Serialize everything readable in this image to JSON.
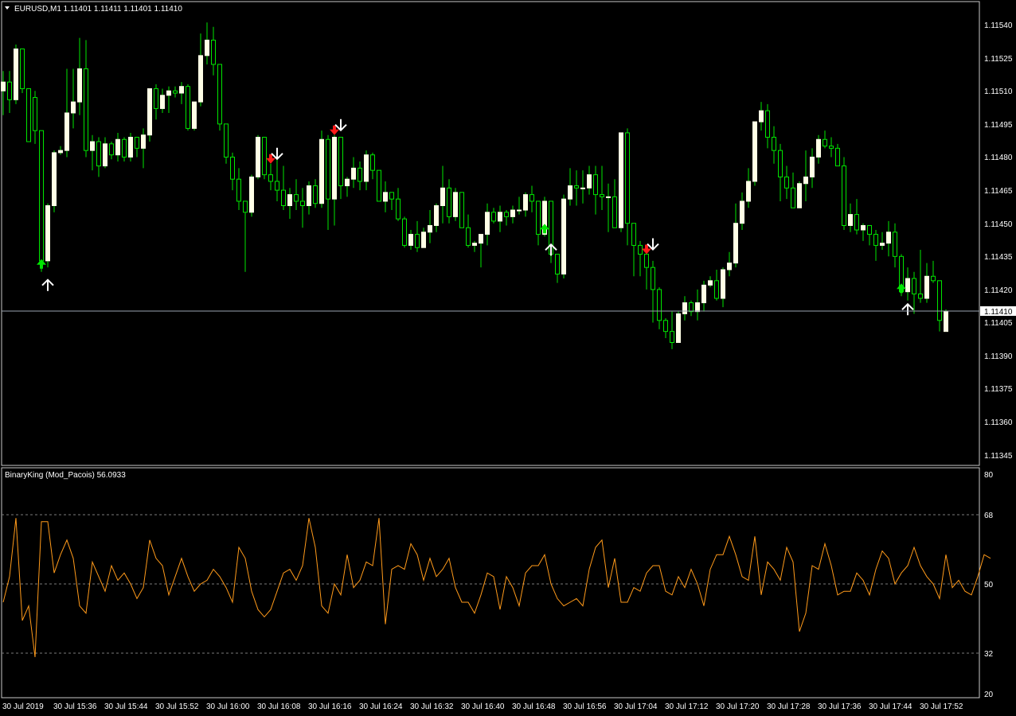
{
  "main_panel": {
    "header": "EURUSD,M1  1.11401 1.11411 1.11401 1.11410",
    "header_icon": "triangle-down-icon",
    "price_ticks": [
      "1.11540",
      "1.11525",
      "1.11510",
      "1.11495",
      "1.11480",
      "1.11465",
      "1.11450",
      "1.11435",
      "1.11420",
      "1.11405",
      "1.11390",
      "1.11375",
      "1.11360",
      "1.11345"
    ],
    "current_price_label": "1.11410"
  },
  "indicator_panel": {
    "header": "BinaryKing (Mod_Pacois) 56.0933",
    "level_ticks": [
      "80",
      "68",
      "50",
      "32",
      "20"
    ],
    "line_color": "#ff9a1a"
  },
  "time_labels": [
    "30 Jul 2019",
    "30 Jul 15:36",
    "30 Jul 15:44",
    "30 Jul 15:52",
    "30 Jul 16:00",
    "30 Jul 16:08",
    "30 Jul 16:16",
    "30 Jul 16:24",
    "30 Jul 16:32",
    "30 Jul 16:40",
    "30 Jul 16:48",
    "30 Jul 16:56",
    "30 Jul 17:04",
    "30 Jul 17:12",
    "30 Jul 17:20",
    "30 Jul 17:28",
    "30 Jul 17:36",
    "30 Jul 17:44",
    "30 Jul 17:52"
  ],
  "colors": {
    "background": "#000000",
    "frame": "#c8c8c8",
    "bull_candle": "#ffffe6",
    "bear_candle": "#000000",
    "wick": "#00e600",
    "price_line": "#9aa3b2",
    "level_lines": "#7a7a7a",
    "signal_up": "#00e600",
    "signal_down": "#ff1a1a",
    "arrow_white": "#ffffff"
  },
  "chart_data": [
    {
      "type": "candlestick",
      "symbol": "EURUSD",
      "timeframe": "M1",
      "ohlc": [
        1.11401,
        1.11411,
        1.11401,
        1.1141
      ],
      "ylim": [
        1.1134,
        1.1155
      ],
      "current_price": 1.1141,
      "candles": [
        [
          1.1151,
          1.11519,
          1.11499,
          1.11514
        ],
        [
          1.11514,
          1.11519,
          1.115,
          1.11506
        ],
        [
          1.11506,
          1.11531,
          1.11504,
          1.11529
        ],
        [
          1.11529,
          1.11529,
          1.11509,
          1.11511
        ],
        [
          1.11511,
          1.11511,
          1.11487,
          1.11487
        ],
        [
          1.11507,
          1.1151,
          1.11486,
          1.11492
        ],
        [
          1.11492,
          1.11492,
          1.11428,
          1.11433
        ],
        [
          1.11433,
          1.11459,
          1.1143,
          1.11458
        ],
        [
          1.11458,
          1.11483,
          1.11455,
          1.11482
        ],
        [
          1.11482,
          1.11485,
          1.11481,
          1.11483
        ],
        [
          1.11483,
          1.1152,
          1.1148,
          1.115
        ],
        [
          1.115,
          1.1152,
          1.11493,
          1.11505
        ],
        [
          1.11505,
          1.11534,
          1.11499,
          1.1152
        ],
        [
          1.1152,
          1.11533,
          1.1148,
          1.11483
        ],
        [
          1.11483,
          1.1149,
          1.11474,
          1.11487
        ],
        [
          1.11487,
          1.11489,
          1.11471,
          1.11476
        ],
        [
          1.11476,
          1.11489,
          1.11475,
          1.11486
        ],
        [
          1.11486,
          1.11487,
          1.11479,
          1.11481
        ],
        [
          1.11481,
          1.11491,
          1.11478,
          1.11488
        ],
        [
          1.11488,
          1.11489,
          1.11478,
          1.1148
        ],
        [
          1.1148,
          1.11491,
          1.11478,
          1.11489
        ],
        [
          1.11489,
          1.11489,
          1.1148,
          1.11484
        ],
        [
          1.11484,
          1.11493,
          1.11475,
          1.1149
        ],
        [
          1.1149,
          1.1151,
          1.11487,
          1.11511
        ],
        [
          1.11511,
          1.11513,
          1.11497,
          1.11502
        ],
        [
          1.11502,
          1.11511,
          1.115,
          1.11508
        ],
        [
          1.11508,
          1.11512,
          1.115,
          1.1151
        ],
        [
          1.1151,
          1.11512,
          1.11507,
          1.11509
        ],
        [
          1.11509,
          1.11514,
          1.11504,
          1.11512
        ],
        [
          1.11512,
          1.11513,
          1.11492,
          1.11493
        ],
        [
          1.11493,
          1.11505,
          1.11492,
          1.11505
        ],
        [
          1.11505,
          1.11536,
          1.11503,
          1.11526
        ],
        [
          1.11526,
          1.11541,
          1.11522,
          1.11533
        ],
        [
          1.11533,
          1.11539,
          1.11517,
          1.11522
        ],
        [
          1.11522,
          1.11522,
          1.11492,
          1.11495
        ],
        [
          1.11495,
          1.11495,
          1.11477,
          1.1148
        ],
        [
          1.1148,
          1.11482,
          1.11465,
          1.1147
        ],
        [
          1.1147,
          1.11475,
          1.11456,
          1.1146
        ],
        [
          1.1146,
          1.1146,
          1.11428,
          1.11455
        ],
        [
          1.11455,
          1.11472,
          1.11453,
          1.11471
        ],
        [
          1.11471,
          1.1149,
          1.1147,
          1.11489
        ],
        [
          1.11489,
          1.11489,
          1.1147,
          1.11472
        ],
        [
          1.11472,
          1.11477,
          1.11465,
          1.11469
        ],
        [
          1.11469,
          1.11479,
          1.1146,
          1.11465
        ],
        [
          1.11465,
          1.11476,
          1.11456,
          1.11458
        ],
        [
          1.11458,
          1.11466,
          1.11452,
          1.11463
        ],
        [
          1.11463,
          1.1147,
          1.11456,
          1.1146
        ],
        [
          1.1146,
          1.11466,
          1.11448,
          1.11458
        ],
        [
          1.11458,
          1.11469,
          1.11454,
          1.11467
        ],
        [
          1.11467,
          1.1147,
          1.11457,
          1.11459
        ],
        [
          1.11459,
          1.11492,
          1.11457,
          1.11488
        ],
        [
          1.11488,
          1.1149,
          1.11447,
          1.11461
        ],
        [
          1.11461,
          1.1149,
          1.11449,
          1.11489
        ],
        [
          1.11489,
          1.11489,
          1.11461,
          1.11467
        ],
        [
          1.11467,
          1.11471,
          1.11462,
          1.1147
        ],
        [
          1.1147,
          1.1148,
          1.11466,
          1.11475
        ],
        [
          1.11475,
          1.11478,
          1.11465,
          1.11469
        ],
        [
          1.11469,
          1.11483,
          1.11465,
          1.11481
        ],
        [
          1.11481,
          1.11482,
          1.1147,
          1.11474
        ],
        [
          1.11474,
          1.11474,
          1.1146,
          1.1146
        ],
        [
          1.1146,
          1.11469,
          1.11455,
          1.11464
        ],
        [
          1.11464,
          1.11464,
          1.11456,
          1.11461
        ],
        [
          1.11461,
          1.11466,
          1.11451,
          1.11452
        ],
        [
          1.11452,
          1.11453,
          1.11439,
          1.1144
        ],
        [
          1.1144,
          1.11447,
          1.11438,
          1.11445
        ],
        [
          1.11445,
          1.11451,
          1.11437,
          1.11439
        ],
        [
          1.11439,
          1.11448,
          1.11441,
          1.11446
        ],
        [
          1.11446,
          1.11456,
          1.11441,
          1.11449
        ],
        [
          1.11449,
          1.11459,
          1.11446,
          1.11458
        ],
        [
          1.11458,
          1.11476,
          1.1145,
          1.11466
        ],
        [
          1.11466,
          1.1147,
          1.1145,
          1.11453
        ],
        [
          1.11453,
          1.11466,
          1.11451,
          1.11464
        ],
        [
          1.11464,
          1.11464,
          1.11448,
          1.11448
        ],
        [
          1.11448,
          1.11454,
          1.11439,
          1.1144
        ],
        [
          1.1144,
          1.11442,
          1.11437,
          1.11441
        ],
        [
          1.11441,
          1.11445,
          1.1143,
          1.11445
        ],
        [
          1.11445,
          1.11459,
          1.1144,
          1.11455
        ],
        [
          1.11455,
          1.11457,
          1.1145,
          1.11451
        ],
        [
          1.11451,
          1.11458,
          1.11446,
          1.11455
        ],
        [
          1.11455,
          1.11456,
          1.11449,
          1.11453
        ],
        [
          1.11453,
          1.11458,
          1.1145,
          1.11456
        ],
        [
          1.11456,
          1.11462,
          1.11454,
          1.11456
        ],
        [
          1.11456,
          1.11464,
          1.11453,
          1.11463
        ],
        [
          1.11463,
          1.11467,
          1.11455,
          1.1146
        ],
        [
          1.1146,
          1.1146,
          1.1144,
          1.11445
        ],
        [
          1.11445,
          1.11462,
          1.11444,
          1.1146
        ],
        [
          1.1146,
          1.1146,
          1.11432,
          1.11436
        ],
        [
          1.11436,
          1.11436,
          1.11423,
          1.11427
        ],
        [
          1.11427,
          1.11463,
          1.11425,
          1.11461
        ],
        [
          1.11461,
          1.11475,
          1.11458,
          1.11467
        ],
        [
          1.11467,
          1.11474,
          1.11458,
          1.11466
        ],
        [
          1.11466,
          1.11474,
          1.11459,
          1.11466
        ],
        [
          1.11466,
          1.11476,
          1.11463,
          1.11472
        ],
        [
          1.11472,
          1.11476,
          1.11454,
          1.11463
        ],
        [
          1.11463,
          1.11476,
          1.11456,
          1.11462
        ],
        [
          1.11462,
          1.11468,
          1.11446,
          1.11462
        ],
        [
          1.11462,
          1.1147,
          1.1145,
          1.11448
        ],
        [
          1.11448,
          1.1148,
          1.11446,
          1.11491
        ],
        [
          1.11491,
          1.11493,
          1.1144,
          1.1145
        ],
        [
          1.1145,
          1.11448,
          1.11426,
          1.1144
        ],
        [
          1.1144,
          1.11442,
          1.11426,
          1.11436
        ],
        [
          1.11436,
          1.11436,
          1.1142,
          1.1143
        ],
        [
          1.1143,
          1.11433,
          1.11405,
          1.1142
        ],
        [
          1.1142,
          1.11421,
          1.11402,
          1.11406
        ],
        [
          1.11406,
          1.11407,
          1.11398,
          1.11401
        ],
        [
          1.11401,
          1.1141,
          1.11393,
          1.11396
        ],
        [
          1.11396,
          1.1141,
          1.11396,
          1.11409
        ],
        [
          1.11409,
          1.11417,
          1.11406,
          1.11414
        ],
        [
          1.11414,
          1.11415,
          1.11408,
          1.1141
        ],
        [
          1.1141,
          1.1142,
          1.11406,
          1.11414
        ],
        [
          1.11414,
          1.11424,
          1.1141,
          1.11422
        ],
        [
          1.11422,
          1.11426,
          1.11421,
          1.11424
        ],
        [
          1.11424,
          1.11429,
          1.11415,
          1.11416
        ],
        [
          1.11416,
          1.1143,
          1.11412,
          1.11429
        ],
        [
          1.11429,
          1.11437,
          1.11426,
          1.11432
        ],
        [
          1.11432,
          1.11459,
          1.1143,
          1.1145
        ],
        [
          1.1145,
          1.11464,
          1.11447,
          1.1146
        ],
        [
          1.1146,
          1.11475,
          1.11457,
          1.11469
        ],
        [
          1.11469,
          1.11492,
          1.11467,
          1.11496
        ],
        [
          1.11496,
          1.11505,
          1.11492,
          1.11501
        ],
        [
          1.11501,
          1.11504,
          1.11484,
          1.11489
        ],
        [
          1.11489,
          1.11494,
          1.11477,
          1.11483
        ],
        [
          1.11483,
          1.11486,
          1.1146,
          1.11471
        ],
        [
          1.11471,
          1.11476,
          1.11461,
          1.11466
        ],
        [
          1.11466,
          1.11473,
          1.11457,
          1.11457
        ],
        [
          1.11457,
          1.11469,
          1.11459,
          1.11468
        ],
        [
          1.11468,
          1.11483,
          1.1146,
          1.11471
        ],
        [
          1.11471,
          1.11484,
          1.11466,
          1.1148
        ],
        [
          1.1148,
          1.1149,
          1.11477,
          1.11488
        ],
        [
          1.11488,
          1.11492,
          1.11484,
          1.11485
        ],
        [
          1.11485,
          1.11489,
          1.1148,
          1.11484
        ],
        [
          1.11484,
          1.11486,
          1.11476,
          1.11476
        ],
        [
          1.11476,
          1.1148,
          1.11447,
          1.11449
        ],
        [
          1.11449,
          1.11459,
          1.11446,
          1.11454
        ],
        [
          1.11454,
          1.11461,
          1.11445,
          1.11447
        ],
        [
          1.11447,
          1.1145,
          1.11442,
          1.11449
        ],
        [
          1.11449,
          1.11446,
          1.1144,
          1.11445
        ],
        [
          1.11445,
          1.11447,
          1.11433,
          1.1144
        ],
        [
          1.1144,
          1.11446,
          1.11438,
          1.11441
        ],
        [
          1.11441,
          1.11451,
          1.11435,
          1.11446
        ],
        [
          1.11446,
          1.1145,
          1.1143,
          1.11435
        ],
        [
          1.11435,
          1.11436,
          1.11417,
          1.11419
        ],
        [
          1.11419,
          1.1143,
          1.11415,
          1.11425
        ],
        [
          1.11425,
          1.11428,
          1.11409,
          1.11418
        ],
        [
          1.11418,
          1.11438,
          1.11414,
          1.11416
        ],
        [
          1.11416,
          1.11432,
          1.11414,
          1.11426
        ],
        [
          1.11426,
          1.11433,
          1.11423,
          1.11424
        ],
        [
          1.11424,
          1.11424,
          1.11401,
          1.11406
        ],
        [
          1.11401,
          1.11411,
          1.11401,
          1.1141
        ]
      ],
      "signals": [
        {
          "index": 6,
          "type": "buy",
          "color": "green",
          "white_arrow": "up"
        },
        {
          "index": 42,
          "type": "sell",
          "color": "red",
          "white_arrow": "down"
        },
        {
          "index": 52,
          "type": "sell",
          "color": "red",
          "white_arrow": "down"
        },
        {
          "index": 85,
          "type": "buy",
          "color": "green",
          "white_arrow": "up"
        },
        {
          "index": 101,
          "type": "sell",
          "color": "red",
          "white_arrow": "down"
        },
        {
          "index": 141,
          "type": "buy",
          "color": "green",
          "white_arrow": "up"
        }
      ]
    },
    {
      "type": "line",
      "name": "BinaryKing (Mod_Pacois)",
      "last_value": 56.0933,
      "ylim": [
        20,
        80
      ],
      "levels": [
        68,
        50,
        32
      ],
      "values": [
        45,
        52,
        68,
        40,
        44,
        30,
        67,
        67,
        53,
        58,
        62,
        57,
        44,
        42,
        56,
        52,
        48,
        55,
        51,
        53,
        50,
        46,
        49,
        62,
        57,
        55,
        47,
        52,
        57,
        52,
        48,
        50,
        51,
        54,
        52,
        49,
        45,
        60,
        57,
        48,
        43,
        41,
        43,
        48,
        53,
        54,
        51,
        55,
        68,
        60,
        44,
        42,
        50,
        47,
        58,
        49,
        51,
        56,
        55,
        68,
        39,
        54,
        55,
        54,
        61,
        58,
        51,
        57,
        52,
        54,
        57,
        49,
        45,
        45,
        42,
        47,
        53,
        52,
        43,
        52,
        49,
        44,
        53,
        55,
        55,
        58,
        50,
        46,
        44,
        45,
        46,
        44,
        54,
        60,
        62,
        49,
        57,
        45,
        45,
        49,
        48,
        53,
        55,
        55,
        48,
        47,
        52,
        49,
        54,
        50,
        44,
        54,
        58,
        58,
        63,
        58,
        52,
        51,
        63,
        47,
        56,
        54,
        51,
        60,
        56,
        37,
        42,
        55,
        54,
        61,
        55,
        47,
        48,
        48,
        53,
        51,
        47,
        54,
        59,
        57,
        50,
        53,
        55,
        60,
        55,
        52,
        50,
        46,
        58,
        49,
        51,
        48,
        47,
        52,
        58,
        57
      ]
    }
  ]
}
